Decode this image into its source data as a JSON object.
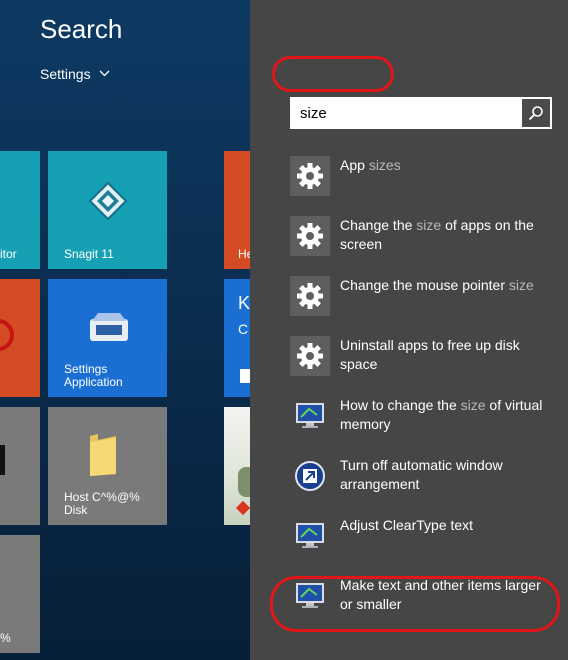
{
  "colors": {
    "highlight": "#e0161a",
    "charm_bg": "#464646",
    "muted_match": "#b9b9b9"
  },
  "tiles": {
    "col1_row1_label": "itor",
    "snagit": "Snagit 11",
    "settings_app": "Settings Application",
    "host_disk": "Host C^%@% Disk",
    "col1_row4_label": "%",
    "right_col_row1_label": "He",
    "right_col_row2_letter_k": "K",
    "right_col_row2_letter_c": "C"
  },
  "charm": {
    "title": "Search",
    "scope_label": "Settings",
    "search": {
      "value": "size",
      "placeholder": ""
    },
    "search_icon": "magnifier-icon",
    "results": [
      {
        "icon": "gear-icon",
        "parts": [
          {
            "t": "App ",
            "m": false
          },
          {
            "t": "sizes",
            "m": true
          }
        ]
      },
      {
        "icon": "gear-icon",
        "parts": [
          {
            "t": "Change the ",
            "m": false
          },
          {
            "t": "size",
            "m": true
          },
          {
            "t": " of apps on the screen",
            "m": false
          }
        ]
      },
      {
        "icon": "gear-icon",
        "parts": [
          {
            "t": "Change the mouse pointer ",
            "m": false
          },
          {
            "t": "size",
            "m": true
          }
        ]
      },
      {
        "icon": "gear-icon",
        "parts": [
          {
            "t": "Uninstall apps to free up disk space",
            "m": false
          }
        ]
      },
      {
        "icon": "monitor-icon",
        "parts": [
          {
            "t": "How to change the ",
            "m": false
          },
          {
            "t": "size",
            "m": true
          },
          {
            "t": " of virtual memory",
            "m": false
          }
        ]
      },
      {
        "icon": "window-arrangement-icon",
        "parts": [
          {
            "t": "Turn off automatic window arrangement",
            "m": false
          }
        ]
      },
      {
        "icon": "monitor-icon",
        "parts": [
          {
            "t": "Adjust ClearType text",
            "m": false
          }
        ]
      },
      {
        "icon": "monitor-icon",
        "parts": [
          {
            "t": "Make text and other items larger or smaller",
            "m": false
          }
        ]
      }
    ]
  }
}
